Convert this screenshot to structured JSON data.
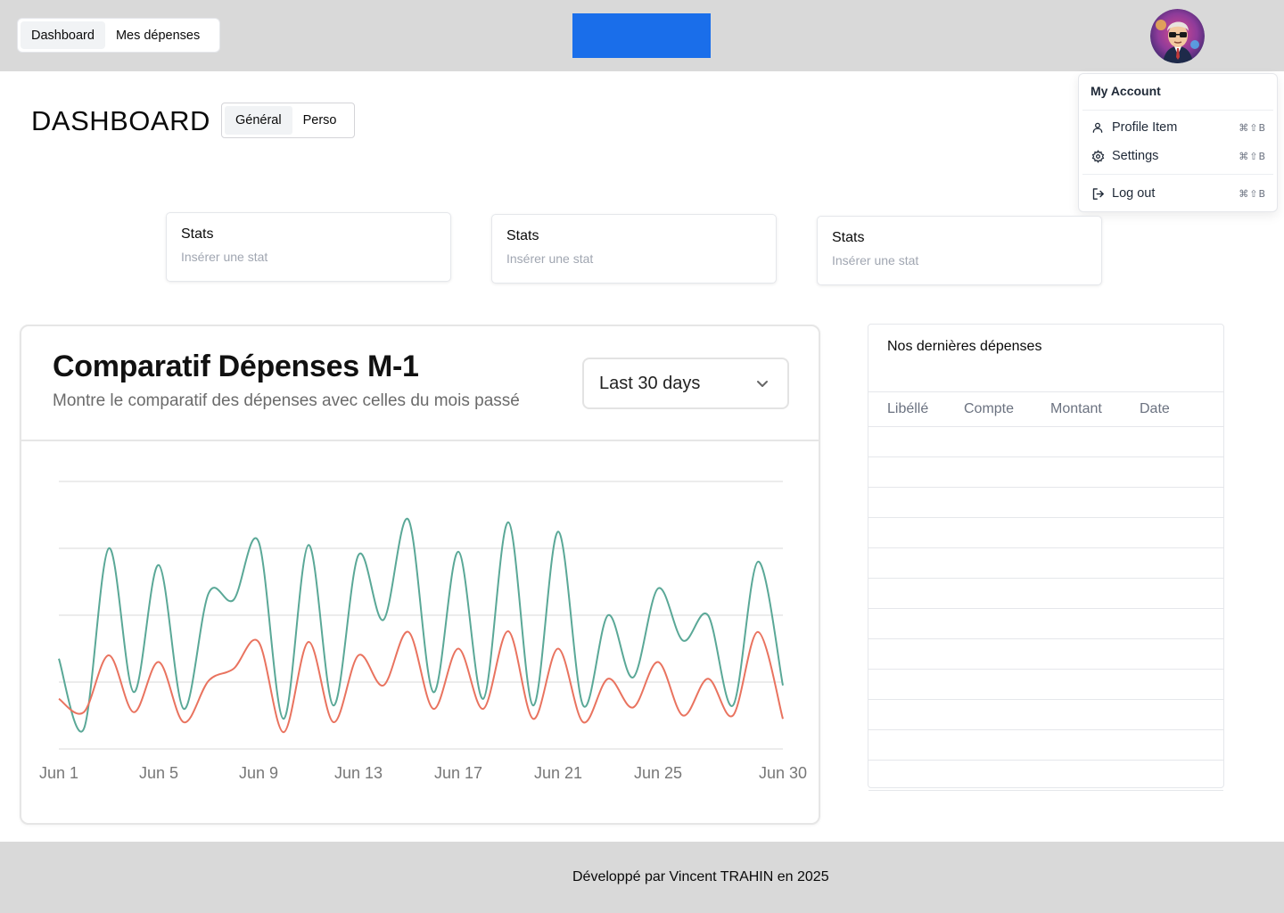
{
  "header": {
    "nav": [
      {
        "label": "Dashboard",
        "active": true
      },
      {
        "label": "Mes dépenses",
        "active": false
      }
    ],
    "logo_color": "#1a6eea"
  },
  "account_menu": {
    "title": "My Account",
    "items": [
      {
        "label": "Profile Item",
        "icon": "user-icon",
        "shortcut": "⌘⇧B"
      },
      {
        "label": "Settings",
        "icon": "gear-icon",
        "shortcut": "⌘⇧B"
      },
      {
        "label": "Log out",
        "icon": "logout-icon",
        "shortcut": "⌘⇧B"
      }
    ]
  },
  "page": {
    "title": "DASHBOARD",
    "tabs": [
      {
        "label": "Général",
        "active": true
      },
      {
        "label": "Perso",
        "active": false
      }
    ]
  },
  "stats": [
    {
      "title": "Stats",
      "subtitle": "Insérer une stat"
    },
    {
      "title": "Stats",
      "subtitle": "Insérer une stat"
    },
    {
      "title": "Stats",
      "subtitle": "Insérer une stat"
    }
  ],
  "chart_card": {
    "title": "Comparatif Dépenses M-1",
    "subtitle": "Montre le comparatif des dépenses avec celles du mois passé",
    "range": "Last 30 days"
  },
  "chart_data": {
    "type": "line",
    "curve": "smooth",
    "grid": true,
    "x": [
      1,
      2,
      3,
      4,
      5,
      6,
      7,
      8,
      9,
      10,
      11,
      12,
      13,
      14,
      15,
      16,
      17,
      18,
      19,
      20,
      21,
      22,
      23,
      24,
      25,
      26,
      27,
      28,
      29,
      30
    ],
    "xticks": [
      1,
      5,
      9,
      13,
      17,
      21,
      25,
      30
    ],
    "xtick_labels": [
      "Jun 1",
      "Jun 5",
      "Jun 9",
      "Jun 13",
      "Jun 17",
      "Jun 21",
      "Jun 25",
      "Jun 30"
    ],
    "ylim": [
      0,
      400
    ],
    "series": [
      {
        "color": "#5aa897",
        "values": [
          135,
          30,
          300,
          85,
          275,
          60,
          233,
          223,
          310,
          45,
          305,
          65,
          290,
          193,
          343,
          85,
          295,
          75,
          339,
          65,
          325,
          65,
          200,
          107,
          240,
          162,
          200,
          65,
          280,
          95
        ]
      },
      {
        "color": "#e9735f",
        "values": [
          75,
          55,
          140,
          55,
          130,
          40,
          102,
          120,
          160,
          25,
          160,
          40,
          140,
          95,
          175,
          60,
          150,
          60,
          176,
          45,
          150,
          40,
          105,
          62,
          130,
          50,
          105,
          50,
          175,
          45
        ]
      }
    ]
  },
  "expenses_table": {
    "title": "Nos dernières dépenses",
    "columns": [
      "Libéllé",
      "Compte",
      "Montant",
      "Date"
    ],
    "rows": 12
  },
  "footer": {
    "text": "Développé par Vincent TRAHIN en 2025"
  }
}
